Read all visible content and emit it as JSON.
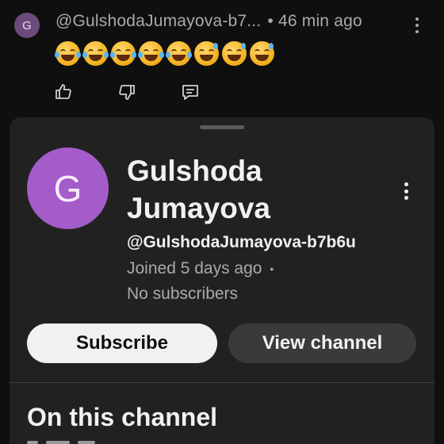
{
  "comment": {
    "avatar_letter": "G",
    "handle": "@GulshodaJumayova-b7...",
    "separator": "•",
    "time": "46 min ago",
    "emojis": [
      "joy",
      "joy",
      "joy",
      "joy",
      "joy",
      "sweat-smile",
      "sweat-smile",
      "sweat-smile"
    ],
    "actions": [
      "thumbs-up-icon",
      "thumbs-down-icon",
      "reply-icon"
    ]
  },
  "channel_sheet": {
    "avatar_letter": "G",
    "name": "Gulshoda Jumayova",
    "handle": "@GulshodaJumayova-b7b6u",
    "joined": "Joined 5 days ago",
    "separator": "•",
    "subscribers": "No subscribers",
    "subscribe_label": "Subscribe",
    "view_channel_label": "View channel",
    "section_title": "On this channel"
  },
  "colors": {
    "background": "#0f0f0f",
    "sheet": "#212121",
    "avatar_purple": "#a45cc9",
    "subscribe_bg": "#f1f1f1",
    "view_channel_bg": "#3a3a3a"
  }
}
